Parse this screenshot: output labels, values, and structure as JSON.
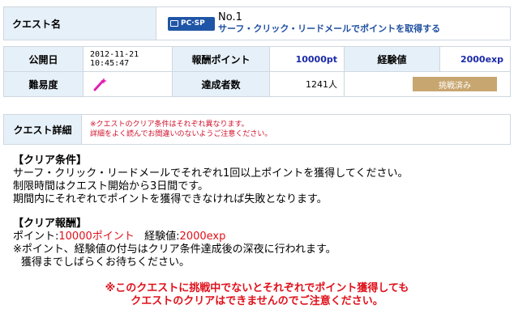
{
  "quest_header": {
    "label": "クエスト名",
    "platform_badge": "PC·SP",
    "number": "No.1",
    "name": "サーフ・クリック・リードメールでポイントを取得する"
  },
  "info": {
    "release_label": "公開日",
    "release_date": "2012-11-21",
    "release_time": "10:45:47",
    "reward_points_label": "報酬ポイント",
    "reward_points": "10000pt",
    "exp_label": "経験値",
    "exp_value": "2000exp",
    "difficulty_label": "難易度",
    "difficulty_icon": "magic-wand-icon",
    "achievers_label": "達成者数",
    "achievers_count": "1241人",
    "status_button": "挑戦済み"
  },
  "detail": {
    "label": "クエスト詳細",
    "note_1": "※クエストのクリア条件はそれぞれ異なります。",
    "note_2": "詳細をよく読んでお間違いのないようご注意ください。"
  },
  "conditions": {
    "heading": "【クリア条件】",
    "line_1": "サーフ・クリック・リードメールでそれぞれ1回以上ポイントを獲得してください。",
    "line_2": "制限時間はクエスト開始から3日間です。",
    "line_3": "期間内にそれぞれでポイントを獲得できなければ失敗となります。"
  },
  "rewards": {
    "heading": "【クリア報酬】",
    "points_prefix": "ポイント:",
    "points_value": "10000ポイント",
    "exp_prefix": "経験値:",
    "exp_value": "2000exp",
    "note_1": "※ポイント、経験値の付与はクリア条件達成後の深夜に行われます。",
    "note_2": "獲得までしばらくお待ちください。"
  },
  "footer": {
    "warning_1": "※このクエストに挑戦中でないとそれぞれでポイント獲得しても",
    "warning_2": "クエストのクリアはできませんのでご注意ください。"
  },
  "colors": {
    "label_bg": "#e6f0f8",
    "border": "#cfd7e0",
    "accent_blue": "#1f55a6",
    "alert_red": "#e0101a",
    "done_button": "#c8a670"
  }
}
